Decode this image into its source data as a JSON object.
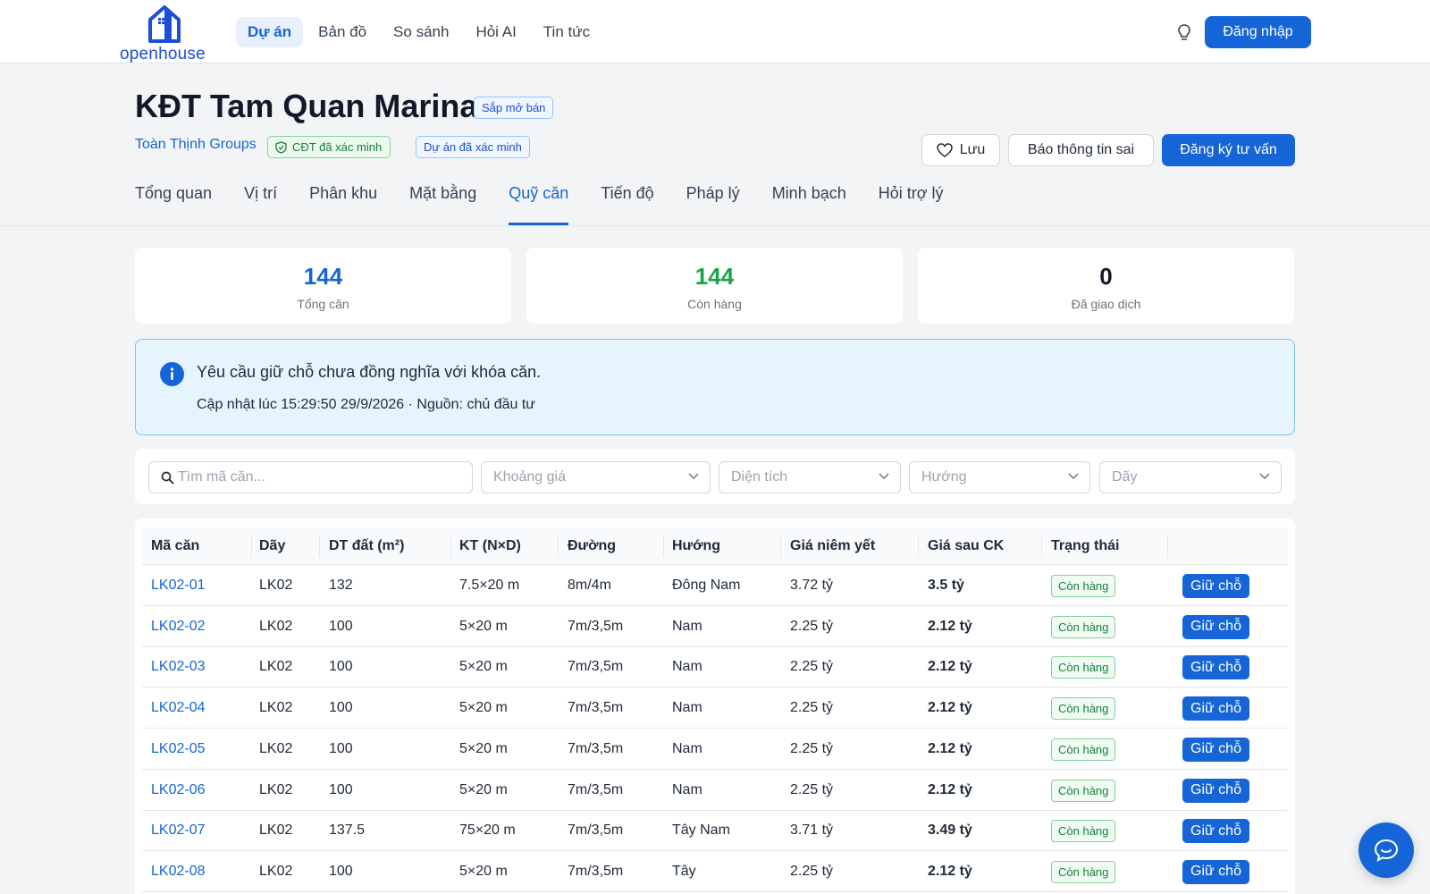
{
  "brand": {
    "name": "openhouse",
    "color": "#1565d8"
  },
  "nav": {
    "items": [
      {
        "label": "Dự án",
        "active": true
      },
      {
        "label": "Bản đồ",
        "active": false
      },
      {
        "label": "So sánh",
        "active": false
      },
      {
        "label": "Hỏi AI",
        "active": false
      },
      {
        "label": "Tin tức",
        "active": false
      }
    ],
    "login_label": "Đăng nhập"
  },
  "project": {
    "title": "KĐT Tam Quan Marina",
    "status": "Sắp mở bán",
    "developer": "Toàn Thịnh Groups",
    "developer_badge": "CĐT đã xác minh",
    "project_badge": "Dự án đã xác minh",
    "save_label": "Lưu",
    "report_label": "Báo thông tin sai",
    "consult_label": "Đăng ký tư vấn"
  },
  "tabs": [
    {
      "label": "Tổng quan",
      "active": false
    },
    {
      "label": "Vị trí",
      "active": false
    },
    {
      "label": "Phân khu",
      "active": false
    },
    {
      "label": "Mặt bằng",
      "active": false
    },
    {
      "label": "Quỹ căn",
      "active": true
    },
    {
      "label": "Tiến độ",
      "active": false
    },
    {
      "label": "Pháp lý",
      "active": false
    },
    {
      "label": "Minh bạch",
      "active": false
    },
    {
      "label": "Hỏi trợ lý",
      "active": false
    }
  ],
  "stats": [
    {
      "value": "144",
      "label": "Tổng căn",
      "color": "#1565d8"
    },
    {
      "value": "144",
      "label": "Còn hàng",
      "color": "#16a34a"
    },
    {
      "value": "0",
      "label": "Đã giao dịch",
      "color": "#111827"
    }
  ],
  "notice": {
    "title": "Yêu cầu giữ chỗ chưa đồng nghĩa với khóa căn.",
    "subtitle": "Cập nhật lúc 15:29:50 29/9/2026 · Nguồn: chủ đầu tư"
  },
  "filters": {
    "search_placeholder": "Tìm mã căn...",
    "price": "Khoảng giá",
    "area": "Diện tích",
    "direction": "Hướng",
    "row": "Dãy"
  },
  "table": {
    "headers": [
      "Mã căn",
      "Dãy",
      "DT đất (m²)",
      "KT (N×D)",
      "Đường",
      "Hướng",
      "Giá niêm yết",
      "Giá sau CK",
      "Trạng thái"
    ],
    "action_label": "Giữ chỗ",
    "rows": [
      {
        "code": "LK02-01",
        "row": "LK02",
        "area": "132",
        "size": "7.5×20 m",
        "road": "8m/4m",
        "direction": "Đông Nam",
        "list_price": "3.72 tỷ",
        "final_price": "3.5 tỷ",
        "status": "Còn hàng"
      },
      {
        "code": "LK02-02",
        "row": "LK02",
        "area": "100",
        "size": "5×20 m",
        "road": "7m/3,5m",
        "direction": "Nam",
        "list_price": "2.25 tỷ",
        "final_price": "2.12 tỷ",
        "status": "Còn hàng"
      },
      {
        "code": "LK02-03",
        "row": "LK02",
        "area": "100",
        "size": "5×20 m",
        "road": "7m/3,5m",
        "direction": "Nam",
        "list_price": "2.25 tỷ",
        "final_price": "2.12 tỷ",
        "status": "Còn hàng"
      },
      {
        "code": "LK02-04",
        "row": "LK02",
        "area": "100",
        "size": "5×20 m",
        "road": "7m/3,5m",
        "direction": "Nam",
        "list_price": "2.25 tỷ",
        "final_price": "2.12 tỷ",
        "status": "Còn hàng"
      },
      {
        "code": "LK02-05",
        "row": "LK02",
        "area": "100",
        "size": "5×20 m",
        "road": "7m/3,5m",
        "direction": "Nam",
        "list_price": "2.25 tỷ",
        "final_price": "2.12 tỷ",
        "status": "Còn hàng"
      },
      {
        "code": "LK02-06",
        "row": "LK02",
        "area": "100",
        "size": "5×20 m",
        "road": "7m/3,5m",
        "direction": "Nam",
        "list_price": "2.25 tỷ",
        "final_price": "2.12 tỷ",
        "status": "Còn hàng"
      },
      {
        "code": "LK02-07",
        "row": "LK02",
        "area": "137.5",
        "size": "75×20 m",
        "road": "7m/3,5m",
        "direction": "Tây Nam",
        "list_price": "3.71 tỷ",
        "final_price": "3.49 tỷ",
        "status": "Còn hàng"
      },
      {
        "code": "LK02-08",
        "row": "LK02",
        "area": "100",
        "size": "5×20 m",
        "road": "7m/3,5m",
        "direction": "Tây",
        "list_price": "2.25 tỷ",
        "final_price": "2.12 tỷ",
        "status": "Còn hàng"
      }
    ]
  }
}
